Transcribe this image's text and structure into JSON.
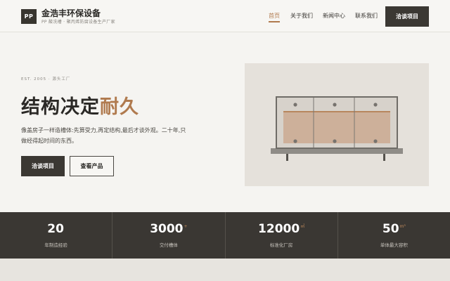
{
  "brand": {
    "logo_text": "PP",
    "name": "金浩丰环保设备",
    "tagline": "PP 酸洗槽 · 聚丙烯防腐设备生产厂家"
  },
  "nav": {
    "items": [
      "首页",
      "关于我们",
      "新闻中心",
      "联系我们"
    ],
    "active": "首页",
    "cta": "洽谈项目"
  },
  "hero": {
    "est": "EST. 2005 · 源头工厂",
    "headline_main": "结构决定",
    "headline_accent": "耐久",
    "description": "像盖房子一样造槽体:先算受力,再定结构,最后才谈外观。二十年,只做经得起时间的东西。",
    "primary_button": "洽谈项目",
    "secondary_button": "查看产品"
  },
  "stats": [
    {
      "value": "20",
      "unit": "",
      "label": "年制造经验"
    },
    {
      "value": "3000",
      "unit": "+",
      "label": "交付槽体"
    },
    {
      "value": "12000",
      "unit": "㎡",
      "label": "标准化厂房"
    },
    {
      "value": "50",
      "unit": "m³",
      "label": "单体最大容积"
    }
  ],
  "colors": {
    "accent": "#b07a4e",
    "dark": "#3a3733",
    "background": "#f5f4f1"
  }
}
